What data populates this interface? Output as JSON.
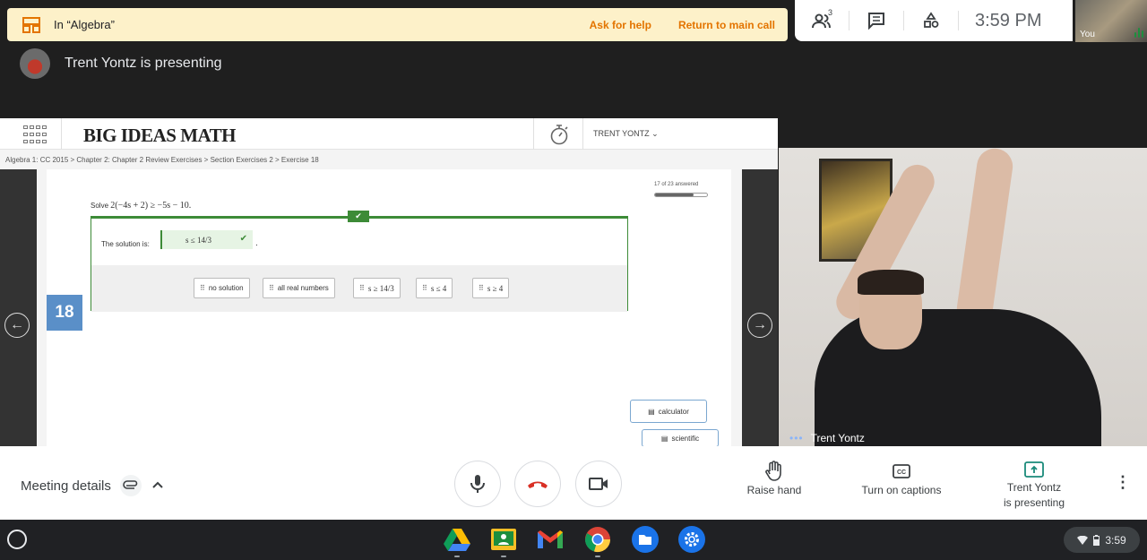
{
  "breakout": {
    "room": "In “Algebra”",
    "ask_help": "Ask for help",
    "return_main": "Return to main call",
    "color": "#fdf1c9",
    "accent": "#e37400"
  },
  "topbar": {
    "participants_count": "3",
    "clock": "3:59 PM",
    "self_label": "You",
    "icons": [
      "people-icon",
      "chat-icon",
      "activities-icon"
    ]
  },
  "presenter": {
    "text": "Trent Yontz is presenting"
  },
  "shared_screen": {
    "logo": "BIG IDEAS MATH",
    "user": "TRENT YONTZ ⌄",
    "breadcrumb": "Algebra 1: CC 2015 > Chapter 2: Chapter 2 Review Exercises > Section Exercises 2 > Exercise 18",
    "progress_text": "17 of 23 answered",
    "progress_value": 0.74,
    "prompt_prefix": "Solve ",
    "prompt_math": "2(−4s + 2) ≥ −5s − 10.",
    "solution_label": "The solution is:",
    "answer": "s ≤ 14/3",
    "exercise_number": "18",
    "choices": [
      "no solution",
      "all real numbers",
      "s ≥ 14/3",
      "s ≤ 4",
      "s ≥ 4"
    ],
    "tools": {
      "calculator": "calculator",
      "scientific": "scientific"
    },
    "accent_green": "#3d8b37",
    "badge_blue": "#5a8fc8"
  },
  "participant": {
    "name": "Trent Yontz"
  },
  "controls": {
    "meeting_details": "Meeting details",
    "raise_hand": "Raise hand",
    "captions": "Turn on captions",
    "presenting_line1": "Trent Yontz",
    "presenting_line2": "is presenting",
    "more": "⋮",
    "end_call_color": "#d93025"
  },
  "shelf": {
    "apps": [
      "google-drive-icon",
      "google-classroom-icon",
      "gmail-icon",
      "chrome-icon",
      "files-icon",
      "settings-icon"
    ],
    "time": "3:59"
  }
}
